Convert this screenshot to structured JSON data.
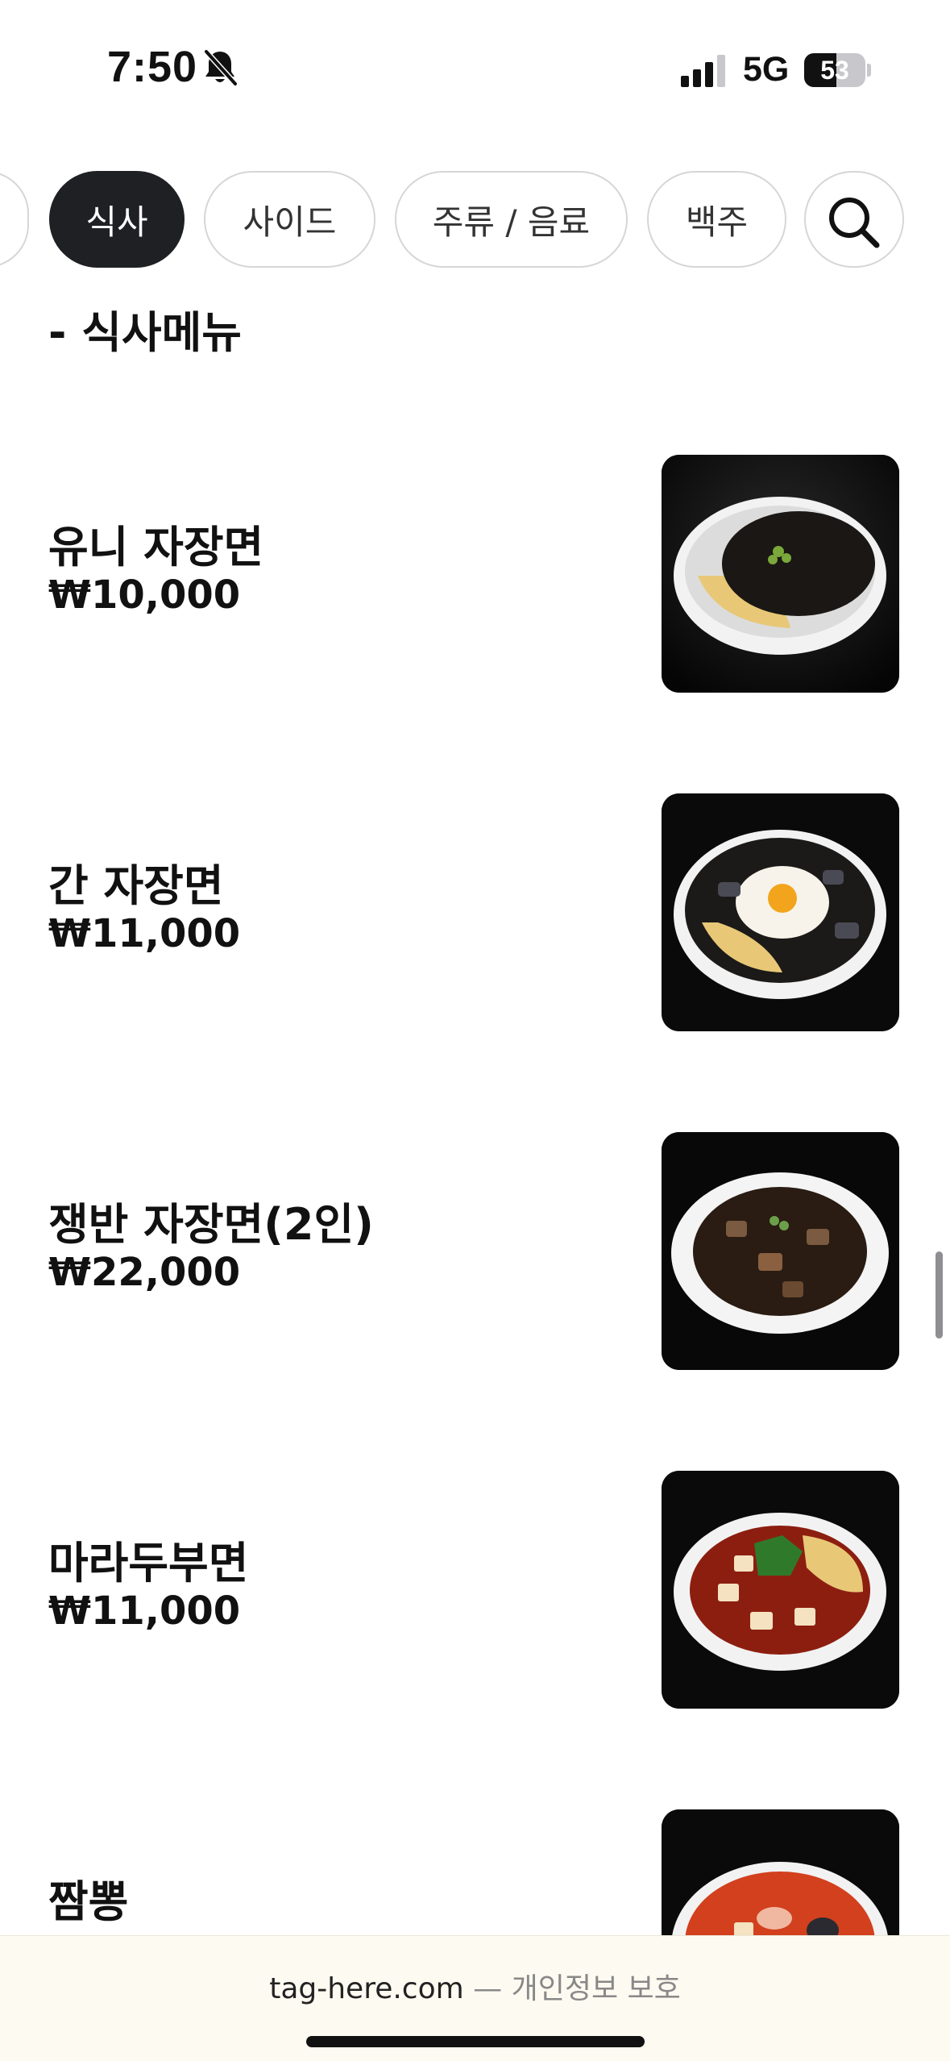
{
  "status_bar": {
    "time": "7:50",
    "network": "5G",
    "battery_level": "53",
    "battery_fraction": 0.53
  },
  "categories": [
    {
      "label": "",
      "active": false
    },
    {
      "label": "식사",
      "active": true
    },
    {
      "label": "사이드",
      "active": false
    },
    {
      "label": "주류 / 음료",
      "active": false
    },
    {
      "label": "백주",
      "active": false
    }
  ],
  "section": {
    "title": "- 식사메뉴"
  },
  "menu_items": [
    {
      "name": "유니 자장면",
      "price": "₩10,000",
      "photo": "jajangmyeon-bowl"
    },
    {
      "name": "간 자장면",
      "price": "₩11,000",
      "photo": "gan-jajangmyeon-with-egg"
    },
    {
      "name": "쟁반 자장면(2인)",
      "price": "₩22,000",
      "photo": "jaengban-jajangmyeon-plate"
    },
    {
      "name": "마라두부면",
      "price": "₩11,000",
      "photo": "mala-tofu-noodles"
    },
    {
      "name": "짬뽕",
      "price": "",
      "photo": "jjamppong-bowl"
    }
  ],
  "footer": {
    "site": "tag-here.com",
    "separator": " — ",
    "privacy": "개인정보 보호"
  },
  "colors": {
    "chip_active_bg": "#1f2024",
    "chip_border": "#d6d6d6",
    "footer_bg": "#fdfaf1"
  },
  "icons": {
    "bell": "bell-slash-icon",
    "signal": "cellular-signal-icon",
    "search": "search-icon"
  }
}
